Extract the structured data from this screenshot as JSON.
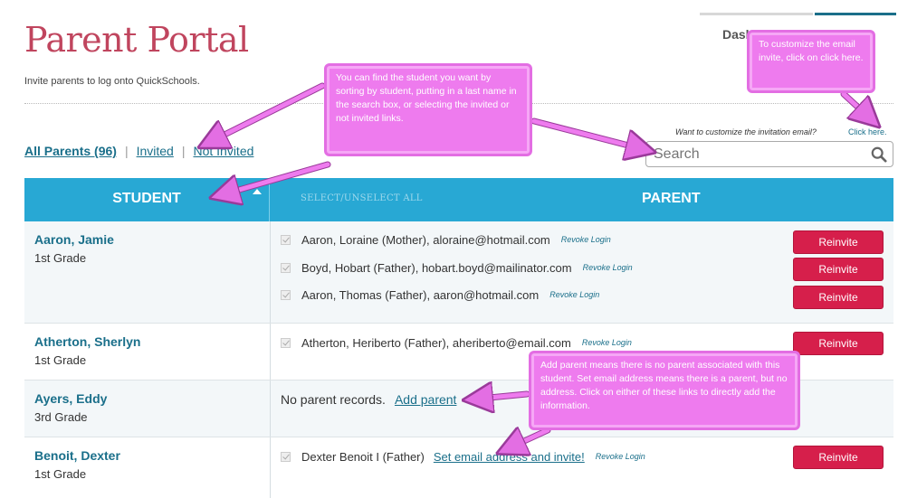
{
  "header": {
    "tab_label": "Dash",
    "title": "Parent Portal",
    "subtitle": "Invite parents to log onto QuickSchools."
  },
  "filters": {
    "all": "All Parents (96)",
    "invited": "Invited",
    "not_invited": "Not Invited",
    "separator": "|"
  },
  "customize": {
    "text": "Want to customize the invitation email?",
    "link": "Click here."
  },
  "search": {
    "placeholder": "Search"
  },
  "table": {
    "student_header": "STUDENT",
    "select_header": "SELECT/UNSELECT ALL",
    "parent_header": "PARENT",
    "reinvite_label": "Reinvite",
    "revoke_label": "Revoke Login",
    "rows": [
      {
        "name": "Aaron, Jamie",
        "grade": "1st Grade",
        "parents": [
          "Aaron, Loraine (Mother), aloraine@hotmail.com",
          "Boyd, Hobart (Father), hobart.boyd@mailinator.com",
          "Aaron, Thomas (Father), aaron@hotmail.com"
        ]
      },
      {
        "name": "Atherton, Sherlyn",
        "grade": "1st Grade",
        "parents": [
          "Atherton, Heriberto (Father), aheriberto@email.com"
        ]
      },
      {
        "name": "Ayers, Eddy",
        "grade": "3rd Grade",
        "no_parent_text": "No parent records.",
        "add_parent_link": "Add parent"
      },
      {
        "name": "Benoit, Dexter",
        "grade": "1st Grade",
        "parents": [
          "Dexter Benoit I (Father)"
        ],
        "set_email_link": "Set email address and invite!"
      }
    ]
  },
  "callouts": {
    "customize": "To customize the email invite, click on click here.",
    "search": "You can find the student you want by sorting by student, putting in a last name in the search box, or selecting the invited or not invited links.",
    "add_parent": "Add parent means there is no parent associated with this student.  Set email address means there is a parent, but no address.  Click on either of these links to directly add the information."
  },
  "colors": {
    "accent": "#1a6f8a",
    "header_blue": "#28a8d4",
    "title_red": "#c0455e",
    "reinvite_red": "#d61f4b",
    "callout_pink": "#ee7bee"
  }
}
